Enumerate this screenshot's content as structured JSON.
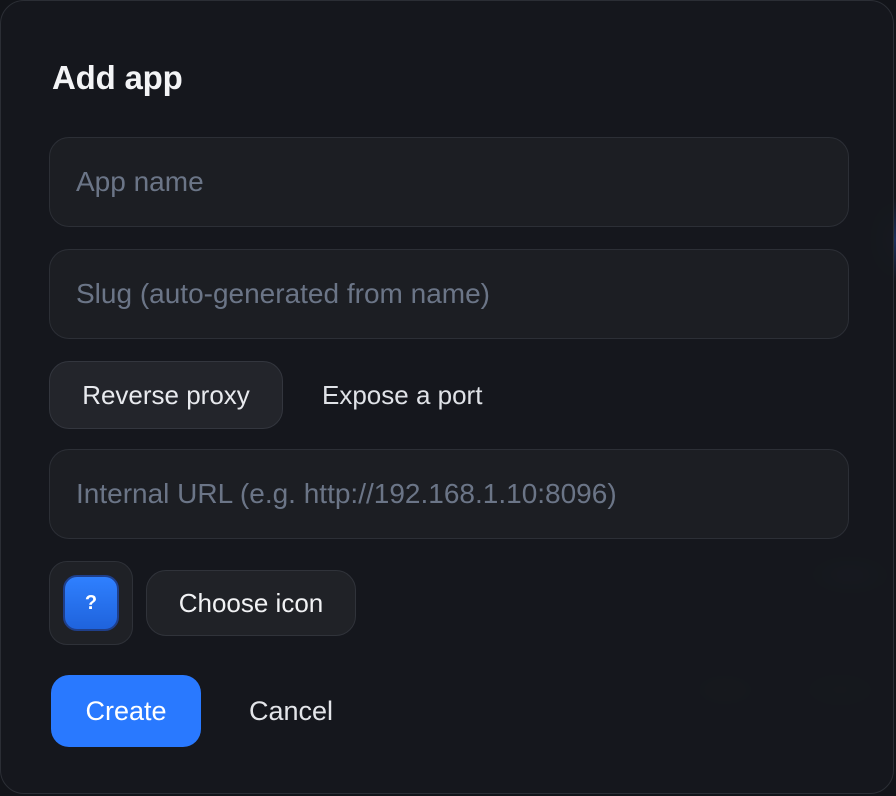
{
  "dialog": {
    "title": "Add app"
  },
  "fields": {
    "name": {
      "placeholder": "App name",
      "value": ""
    },
    "slug": {
      "placeholder": "Slug (auto-generated from name)",
      "value": ""
    },
    "internal_url": {
      "placeholder": "Internal URL (e.g. http://192.168.1.10:8096)",
      "value": ""
    }
  },
  "mode": {
    "options": [
      "Reverse proxy",
      "Expose a port"
    ],
    "selected": "Reverse proxy"
  },
  "icon": {
    "preview_glyph": "?",
    "preview_icon": "question-mark-icon",
    "choose_label": "Choose icon"
  },
  "actions": {
    "create_label": "Create",
    "cancel_label": "Cancel"
  },
  "colors": {
    "accent": "#2979ff",
    "background": "#16181d",
    "field_background": "#1c1e23",
    "placeholder": "#6b7587"
  }
}
